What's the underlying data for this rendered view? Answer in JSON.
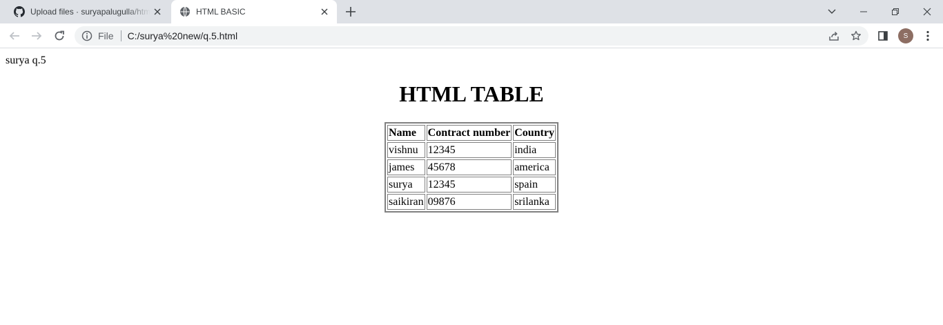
{
  "browser": {
    "tabs": [
      {
        "title": "Upload files · suryapalugulla/html",
        "favicon": "github-icon"
      },
      {
        "title": "HTML BASIC",
        "favicon": "globe-icon"
      }
    ],
    "address": {
      "scheme_label": "File",
      "url": "C:/surya%20new/q.5.html"
    },
    "profile_initial": "S",
    "colors": {
      "tabstrip": "#dee1e6",
      "omnibox": "#f1f3f4",
      "avatar": "#8d6e63"
    }
  },
  "page": {
    "intro_text": "surya q.5",
    "heading": "HTML TABLE",
    "table": {
      "headers": [
        "Name",
        "Contract number",
        "Country"
      ],
      "rows": [
        [
          "vishnu",
          "12345",
          "india"
        ],
        [
          "james",
          "45678",
          "america"
        ],
        [
          "surya",
          "12345",
          "spain"
        ],
        [
          "saikiran",
          "09876",
          "srilanka"
        ]
      ]
    }
  }
}
